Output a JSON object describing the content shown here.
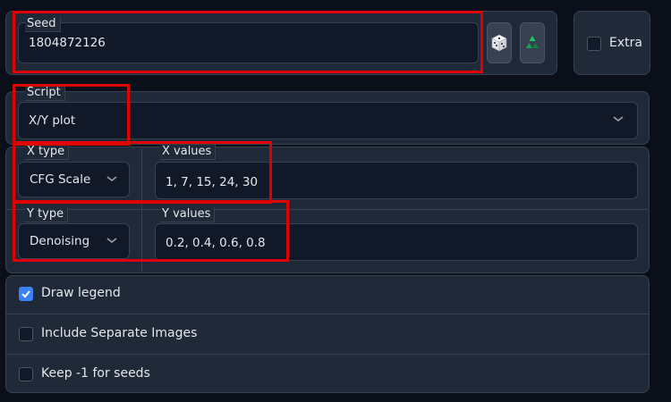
{
  "seed": {
    "label": "Seed",
    "value": "1804872126"
  },
  "buttons": {
    "random_icon": "dice-icon",
    "reuse_icon": "recycle-icon"
  },
  "extra": {
    "label": "Extra",
    "checked": false
  },
  "script": {
    "label": "Script",
    "value": "X/Y plot"
  },
  "x_type": {
    "label": "X type",
    "value": "CFG Scale"
  },
  "x_values": {
    "label": "X values",
    "value": "1, 7, 15, 24, 30"
  },
  "y_type": {
    "label": "Y type",
    "value": "Denoising"
  },
  "y_values": {
    "label": "Y values",
    "value": "0.2, 0.4, 0.6, 0.8"
  },
  "options": [
    {
      "label": "Draw legend",
      "checked": true
    },
    {
      "label": "Include Separate Images",
      "checked": false
    },
    {
      "label": "Keep -1 for seeds",
      "checked": false
    }
  ],
  "colors": {
    "highlight": "#e00000",
    "accent": "#3b82f6",
    "background": "#0b0f19",
    "panel": "#1f2937"
  }
}
